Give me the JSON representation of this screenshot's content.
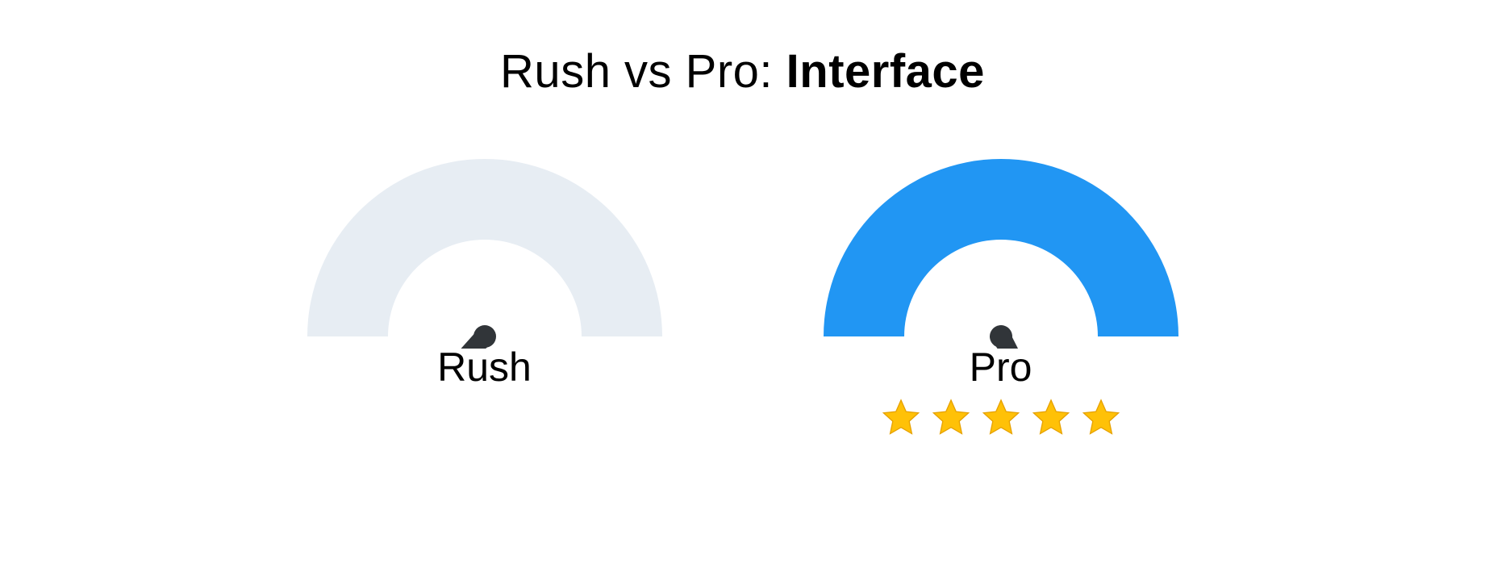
{
  "title": {
    "prefix": "Rush vs Pro: ",
    "bold": "Interface"
  },
  "chart_data": {
    "type": "bar",
    "description": "Two semicircular gauge meters comparing Rush and Pro on the 'Interface' dimension. Needle angle interpreted on a 0–100 scale where 0 is far left and 100 is far right.",
    "categories": [
      "Rush",
      "Pro"
    ],
    "values": [
      25,
      80
    ],
    "xlabel": "",
    "ylabel": "",
    "ylim": [
      0,
      100
    ],
    "series": [
      {
        "name": "Rush",
        "value": 25,
        "arc_color": "#E7EDF3",
        "stars": 0
      },
      {
        "name": "Pro",
        "value": 80,
        "arc_color": "#2196F3",
        "stars": 5
      }
    ],
    "needle_color": "#313539",
    "star_color": "#FFC107"
  },
  "gauges": {
    "rush": {
      "label": "Rush"
    },
    "pro": {
      "label": "Pro"
    }
  }
}
